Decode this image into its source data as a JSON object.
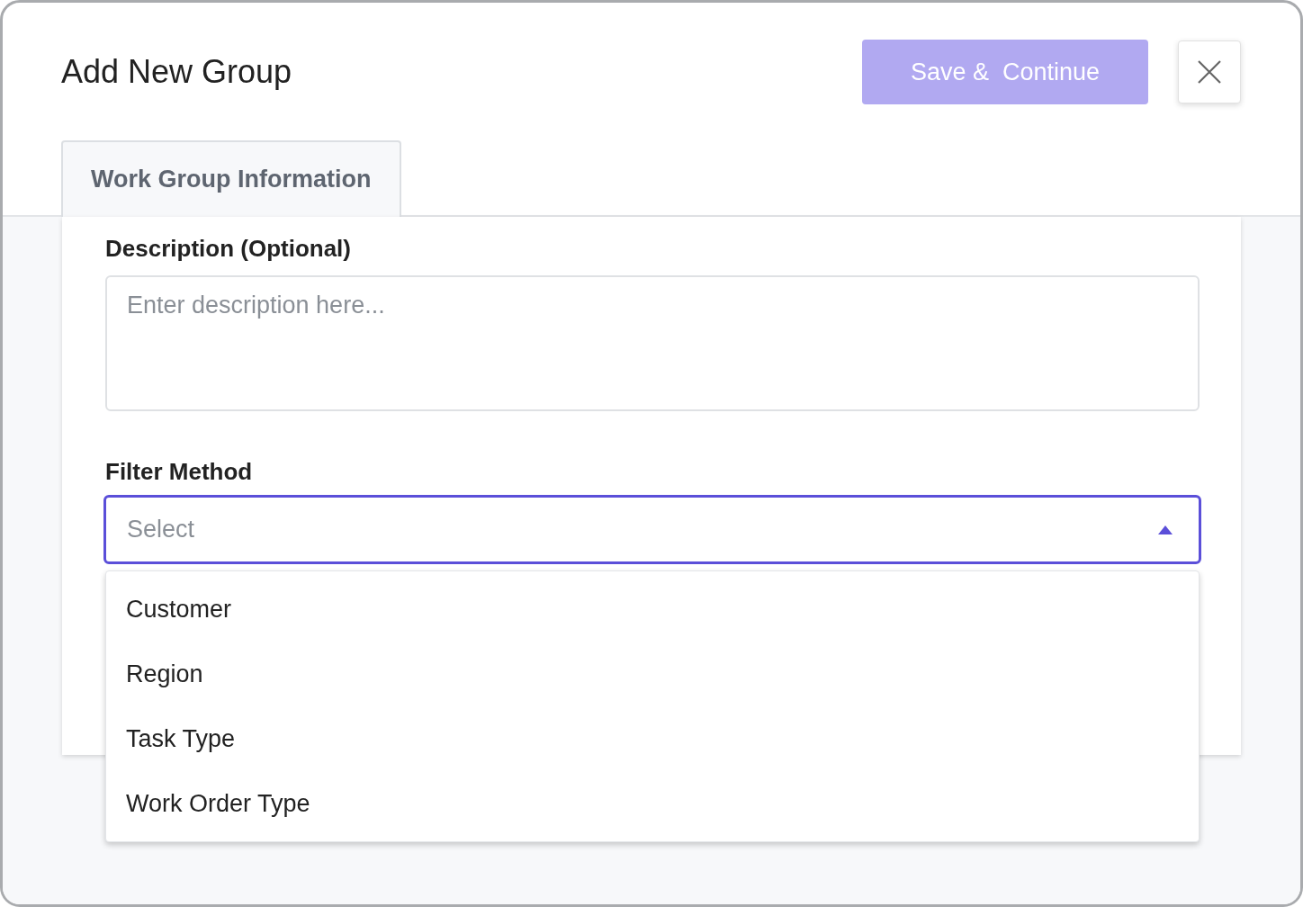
{
  "dialog": {
    "title": "Add New Group",
    "save_button": {
      "label": "Save &  Continue",
      "disabled": true
    }
  },
  "tabs": [
    {
      "label": "Work Group Information",
      "selected": true
    }
  ],
  "form": {
    "description": {
      "label": "Description (Optional)",
      "placeholder": "Enter description here..."
    },
    "filter_method": {
      "label": "Filter Method",
      "placeholder": "Select",
      "expanded": true,
      "options": [
        {
          "label": "Customer"
        },
        {
          "label": "Region"
        },
        {
          "label": "Task Type"
        },
        {
          "label": "Work Order Type"
        }
      ]
    }
  }
}
